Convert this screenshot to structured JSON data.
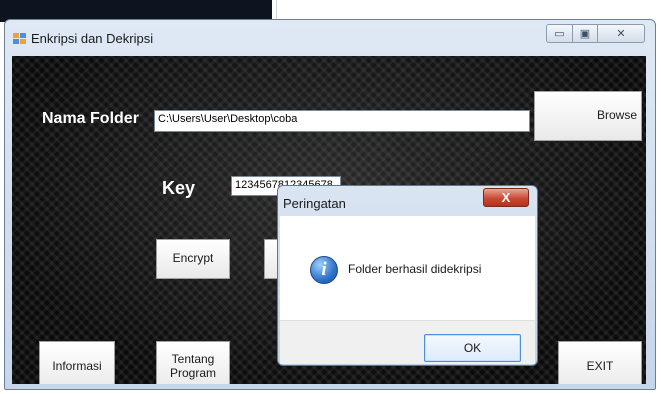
{
  "window": {
    "title": "Enkripsi dan Dekripsi",
    "controls": {
      "minimize": "▭",
      "maximize": "▣",
      "close": "✕"
    }
  },
  "form": {
    "folder_label": "Nama Folder",
    "folder_value": "C:\\Users\\User\\Desktop\\coba",
    "key_label": "Key",
    "key_value": "1234567812345678",
    "browse_label": "Browse",
    "encrypt_label": "Encrypt",
    "info_label": "Informasi",
    "about_label_line1": "Tentang",
    "about_label_line2": "Program",
    "exit_label": "EXIT"
  },
  "dialog": {
    "title": "Peringatan",
    "close_glyph": "X",
    "icon": "information-icon",
    "message": "Folder berhasil didekripsi",
    "ok_label": "OK"
  },
  "colors": {
    "dialog_close": "#c94a33",
    "info_icon": "#2f72c8",
    "background": "#0b0b0b"
  }
}
